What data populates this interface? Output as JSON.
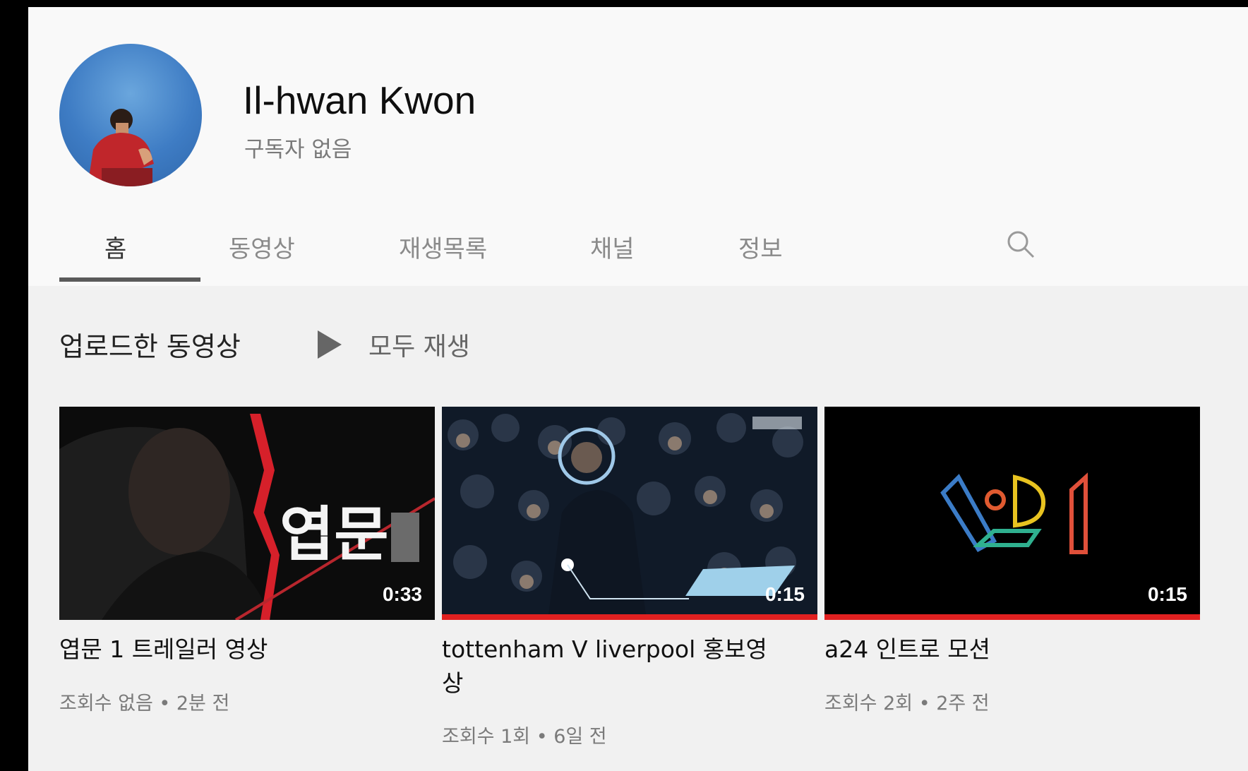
{
  "channel": {
    "name": "Il-hwan Kwon",
    "subscribers": "구독자 없음",
    "avatar_icon": "person-avatar-icon"
  },
  "tabs": [
    {
      "label": "홈",
      "active": true
    },
    {
      "label": "동영상",
      "active": false
    },
    {
      "label": "재생목록",
      "active": false
    },
    {
      "label": "채널",
      "active": false
    },
    {
      "label": "정보",
      "active": false
    }
  ],
  "tab_search_icon": "search-icon",
  "section": {
    "title": "업로드한 동영상",
    "play_all_label": "모두 재생",
    "play_all_icon": "play-icon"
  },
  "videos": [
    {
      "title": "엽문 1 트레일러 영상",
      "duration": "0:33",
      "meta": "조회수 없음 • 2분 전",
      "thumb_text": "엽문",
      "watched_progress": 0
    },
    {
      "title": "tottenham V liverpool 홍보영상",
      "duration": "0:15",
      "meta": "조회수 1회 • 6일 전",
      "watched_progress": 1
    },
    {
      "title": "a24 인트로 모션",
      "duration": "0:15",
      "meta": "조회수 2회 • 2주 전",
      "watched_progress": 1
    }
  ],
  "colors": {
    "progress": "#e02020",
    "header_bg": "#f9f9f9",
    "page_bg": "#f1f1f1"
  }
}
